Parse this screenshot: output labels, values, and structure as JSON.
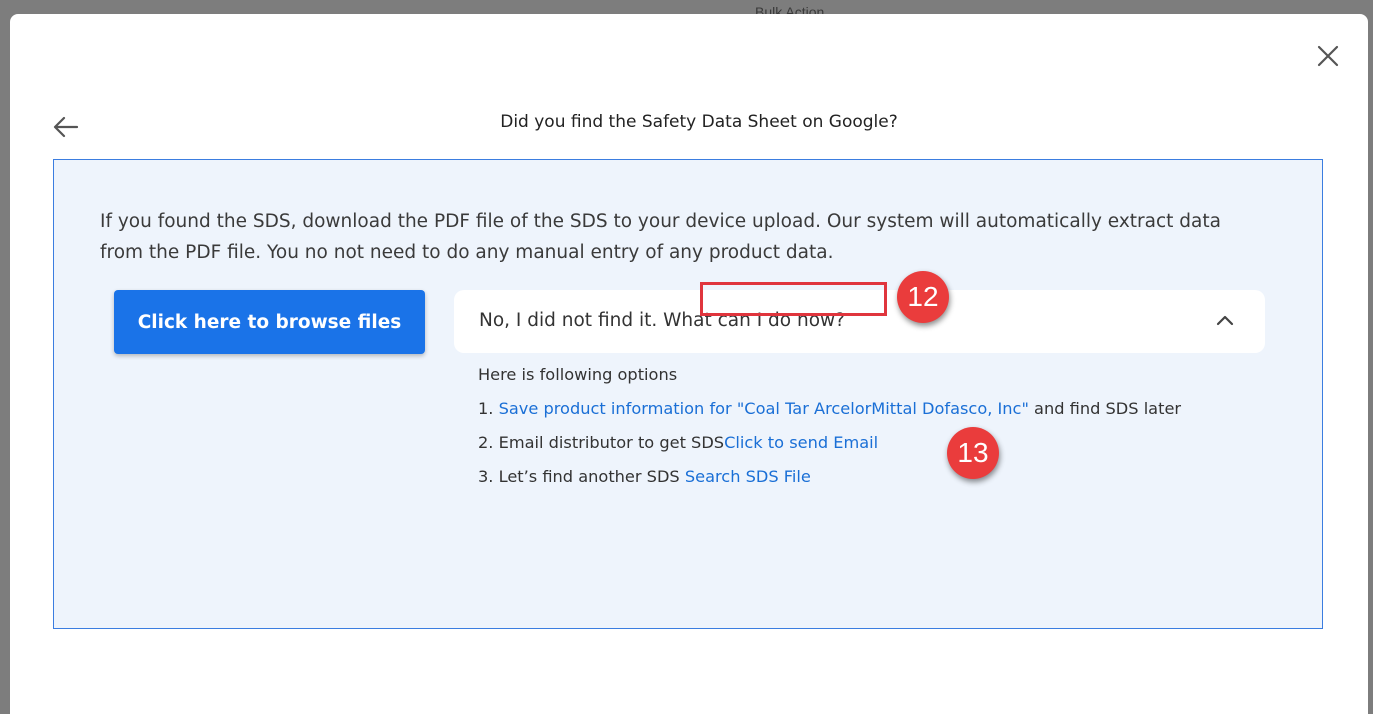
{
  "backdrop": {
    "label": "Bulk Action"
  },
  "modal": {
    "title": "Did you find the Safety Data Sheet on Google?",
    "intro": "If you found the SDS, download the PDF file of the SDS to your device upload. Our system will automatically extract data from the PDF file. You no not need to do any manual entry of any product data.",
    "browse_button": "Click here to browse files",
    "accordion": {
      "question": "No, I did not find it. What can I do now?",
      "expanded": true,
      "intro": "Here is following options",
      "options": [
        {
          "prefix": "1. ",
          "link": "Save product information for \"Coal Tar ArcelorMittal Dofasco, Inc\"",
          "suffix": " and find SDS later"
        },
        {
          "prefix": "2. Email distributor to get SDS",
          "link": "Click to send Email",
          "suffix": ""
        },
        {
          "prefix": "3. Let’s find another SDS ",
          "link": "Search SDS File",
          "suffix": ""
        }
      ]
    },
    "icons": {
      "close": "close-icon",
      "back": "arrow-left-icon",
      "chevron": "chevron-up-icon"
    }
  },
  "annotations": {
    "badge_12": "12",
    "badge_13": "13",
    "badge_color": "#ea3c3c",
    "highlight_color": "#e0353d"
  },
  "colors": {
    "primary": "#1a73e8",
    "link": "#1a6fd6",
    "panel_bg": "#eef4fc",
    "panel_border": "#3b7de0"
  }
}
